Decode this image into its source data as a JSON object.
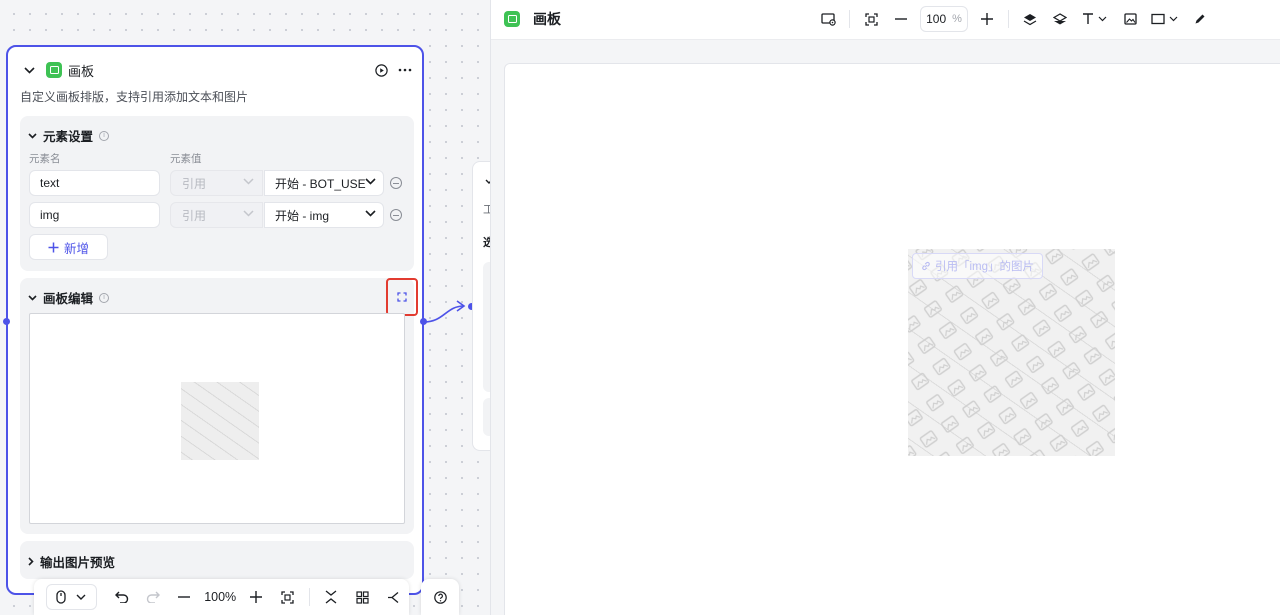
{
  "node": {
    "title": "画板",
    "description": "自定义画板排版，支持引用添加文本和图片",
    "elements_section": {
      "title": "元素设置",
      "col_name": "元素名",
      "col_value": "元素值",
      "rows": [
        {
          "name": "text",
          "type": "引用",
          "value": "开始 - BOT_USE"
        },
        {
          "name": "img",
          "type": "引用",
          "value": "开始 - img"
        }
      ],
      "add_label": "新增"
    },
    "board_section": {
      "title": "画板编辑"
    },
    "preview_section": {
      "title": "输出图片预览"
    }
  },
  "next_node": {
    "labels": [
      "工",
      "选"
    ]
  },
  "bottom_toolbar": {
    "zoom": "100%"
  },
  "editor": {
    "title": "画板",
    "zoom_value": "100",
    "zoom_unit": "%",
    "image_label": "引用「img」的图片"
  },
  "colors": {
    "accent": "#4d53e8",
    "app_icon": "#3ec254",
    "highlight": "#e23b30"
  }
}
